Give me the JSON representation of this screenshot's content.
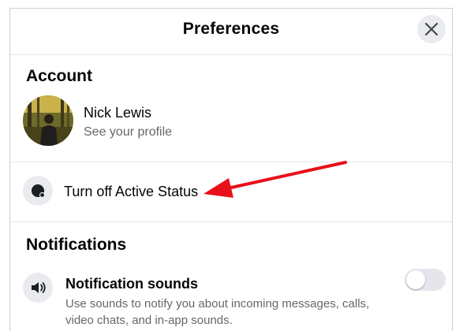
{
  "header": {
    "title": "Preferences",
    "close_icon": "close-icon"
  },
  "account": {
    "section_title": "Account",
    "profile_name": "Nick Lewis",
    "profile_subtitle": "See your profile"
  },
  "active_status": {
    "label": "Turn off Active Status",
    "icon": "active-status-icon"
  },
  "notifications": {
    "section_title": "Notifications",
    "sounds_title": "Notification sounds",
    "sounds_description": "Use sounds to notify you about incoming messages, calls, video chats, and in-app sounds.",
    "sounds_icon": "speaker-icon",
    "sounds_enabled": false
  },
  "annotation": {
    "arrow_color": "#e8101a"
  },
  "colors": {
    "secondary_text": "#65676b",
    "icon_bg": "#e9ebee",
    "divider": "#e4e6eb"
  }
}
